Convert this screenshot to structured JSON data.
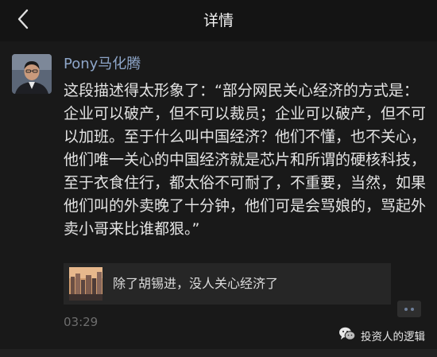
{
  "nav": {
    "title": "详情"
  },
  "post": {
    "author": "Pony马化腾",
    "text": "这段描述得太形象了：“部分网民关心经济的方式是：企业可以破产，但不可以裁员；企业可以破产，但不可以加班。至于什么叫中国经济？他们不懂，也不关心，他们唯一关心的中国经济就是芯片和所谓的硬核科技，至于衣食住行，都太俗不可耐了，不重要，当然，如果他们叫的外卖晚了十分钟，他们可是会骂娘的，骂起外卖小哥来比谁都狠。”",
    "timestamp": "03:29"
  },
  "link_card": {
    "title": "除了胡锡进，没人关心经济了"
  },
  "watermark": {
    "text": "投资人的逻辑"
  },
  "icons": {
    "back": "chevron-left-icon",
    "more": "more-dots-icon",
    "watermark": "wechat-logo-icon"
  },
  "colors": {
    "background": "#191919",
    "author": "#8ea6c9",
    "text": "#e3e3e3",
    "timestamp": "#6d6d6d"
  }
}
